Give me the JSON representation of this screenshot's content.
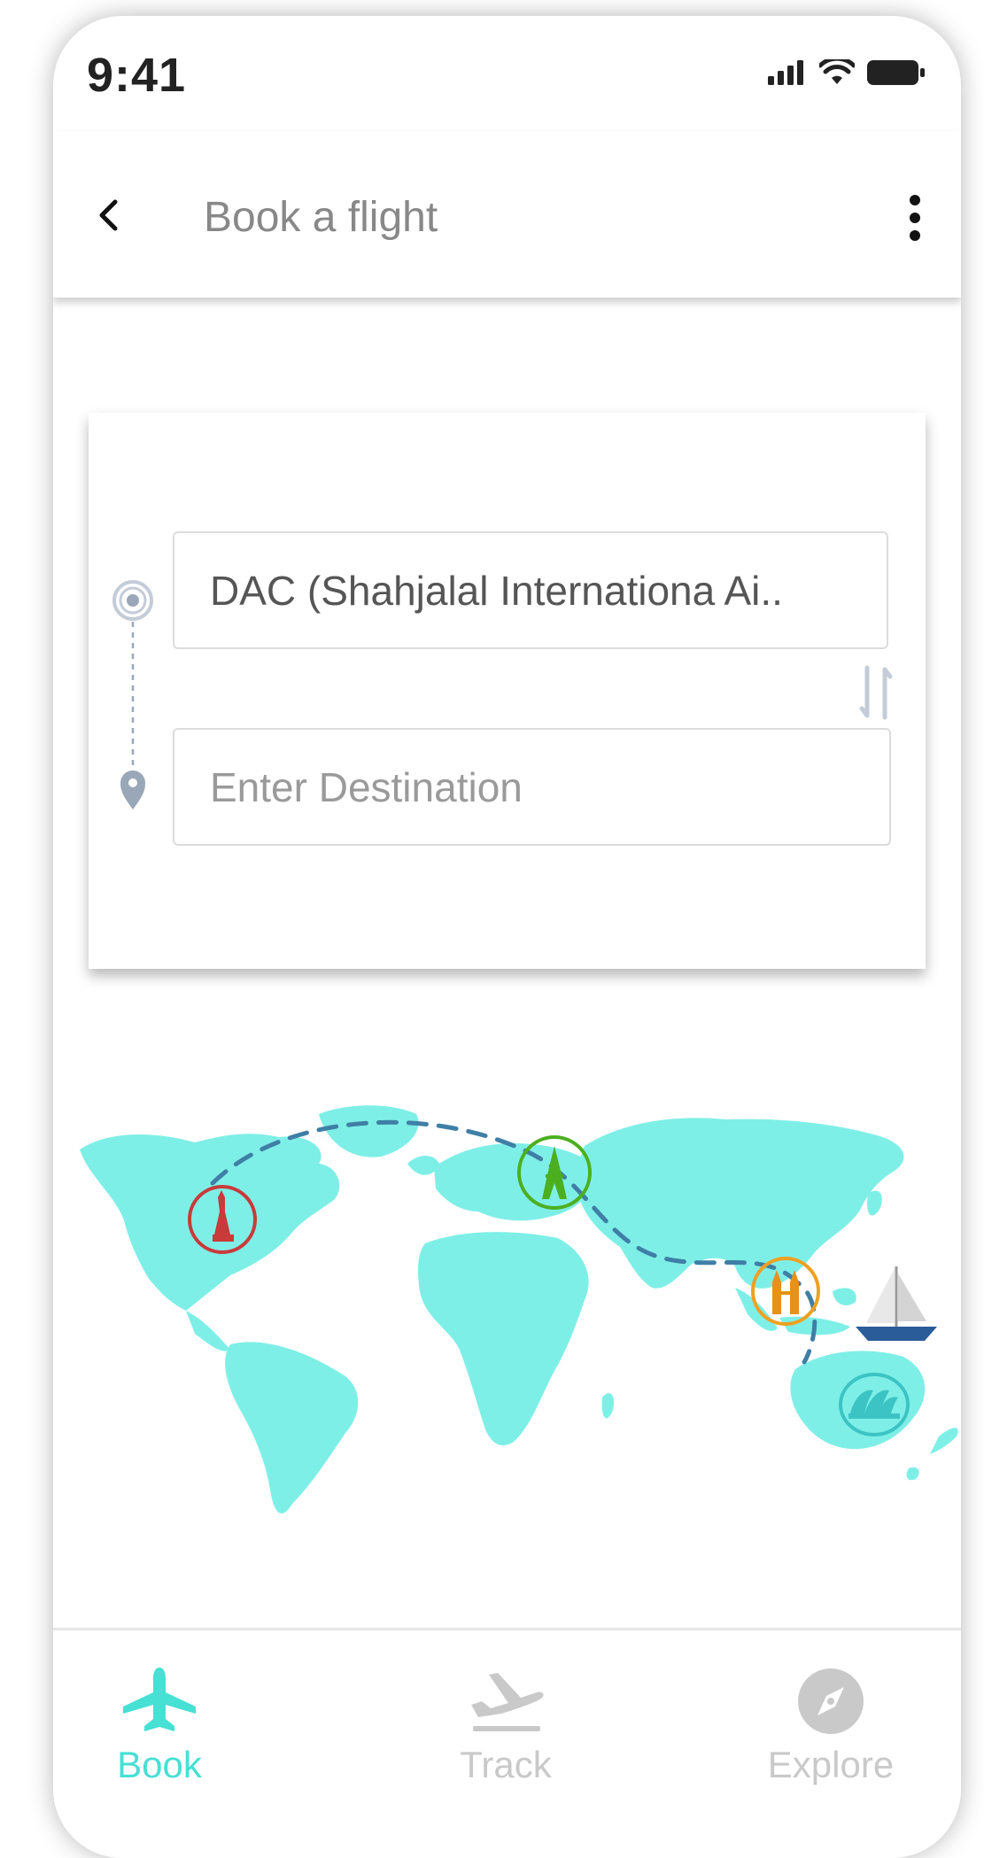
{
  "status_bar": {
    "time": "9:41",
    "icons": [
      "signal-icon",
      "wifi-icon",
      "battery-icon"
    ]
  },
  "app_bar": {
    "title": "Book a flight",
    "back_icon": "chevron-left-icon",
    "menu_icon": "more-vertical-icon"
  },
  "booking_form": {
    "origin_value": "DAC (Shahjalal Internationa Ai..",
    "destination_placeholder": "Enter Destination",
    "swap_icon": "swap-icon"
  },
  "map": {
    "landmarks": [
      "statue-of-liberty-icon",
      "eiffel-tower-icon",
      "petronas-towers-icon",
      "sydney-opera-house-icon",
      "sailboat-icon"
    ]
  },
  "bottom_nav": {
    "items": [
      {
        "label": "Book",
        "icon": "airplane-icon",
        "active": true
      },
      {
        "label": "Track",
        "icon": "airplane-takeoff-icon",
        "active": false
      },
      {
        "label": "Explore",
        "icon": "compass-icon",
        "active": false
      }
    ]
  },
  "colors": {
    "accent": "#46e0d4",
    "map_land": "#7eefe7",
    "inactive": "#c9c9c9",
    "title": "#888888"
  }
}
